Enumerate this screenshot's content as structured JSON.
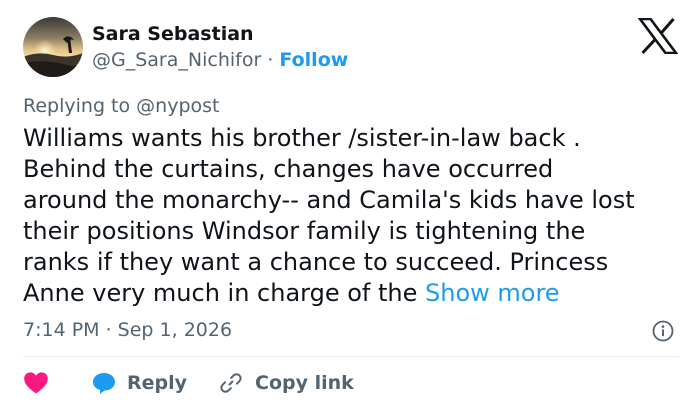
{
  "author": {
    "name": "Sara Sebastian",
    "handle": "@G_Sara_Nichifor",
    "separator": "·",
    "follow_label": "Follow"
  },
  "reply_context": {
    "prefix": "Replying to ",
    "mention": "@nypost"
  },
  "tweet": {
    "text": "Williams wants his brother /sister-in-law back .\nBehind the curtains, changes have occurred\naround the monarchy-- and Camila's kids have lost\ntheir positions  Windsor family is tightening the\nranks if they want a chance to succeed. Princess\nAnne  very much in charge of the ",
    "show_more_label": "Show more",
    "timestamp": "7:14 PM · Sep 1, 2026"
  },
  "actions": {
    "reply_label": "Reply",
    "copy_link_label": "Copy link"
  },
  "icons": {
    "logo": "x-logo-icon",
    "info": "info-icon",
    "like": "heart-icon",
    "reply": "speech-bubble-icon",
    "copy_link": "link-icon"
  },
  "colors": {
    "accent": "#1d9bf0",
    "text": "#0f1419",
    "muted": "#536471",
    "like": "#f91880",
    "divider": "#e6ecf0"
  }
}
